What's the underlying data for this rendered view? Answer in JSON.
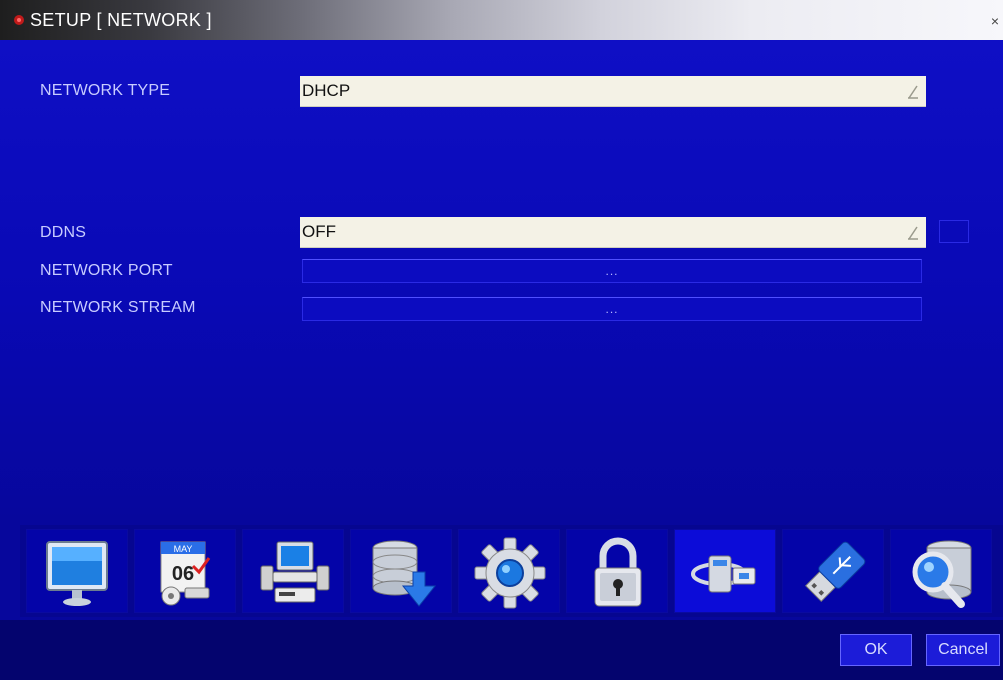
{
  "window": {
    "title": "SETUP [ NETWORK ]",
    "close_glyph": "×"
  },
  "form": {
    "network_type_label": "NETWORK TYPE",
    "network_type_value": "DHCP",
    "ddns_label": "DDNS",
    "ddns_value": "OFF",
    "network_port_label": "NETWORK PORT",
    "network_port_value": "...",
    "network_stream_label": "NETWORK STREAM",
    "network_stream_value": "..."
  },
  "menu": {
    "icons": [
      "display-icon",
      "calendar-icon",
      "devices-icon",
      "storage-download-icon",
      "gear-icon",
      "lock-icon",
      "network-icon",
      "usb-icon",
      "search-database-icon"
    ],
    "active_index": 6,
    "calendar_month": "MAY",
    "calendar_day": "06"
  },
  "buttons": {
    "ok": "OK",
    "cancel": "Cancel"
  },
  "colors": {
    "background": "#0a0ab0",
    "field_bg": "#f4f2e6",
    "label_text": "#c8ccff"
  }
}
